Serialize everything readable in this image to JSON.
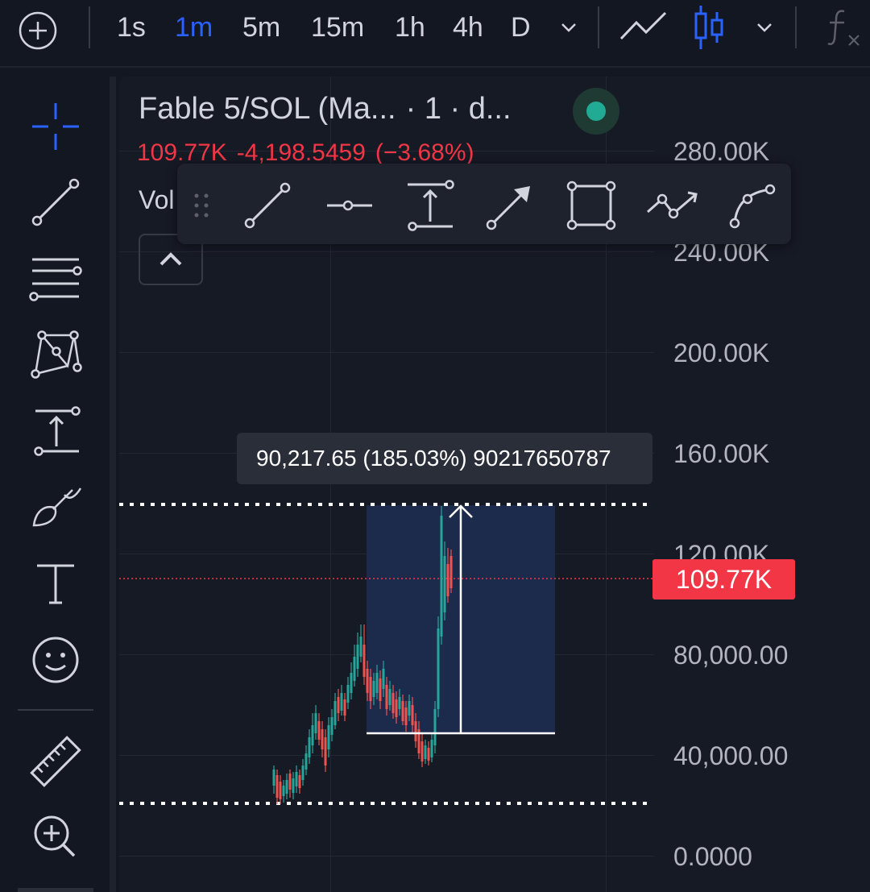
{
  "toolbar": {
    "add_icon": "plus-circle-icon",
    "intervals": [
      {
        "label": "1s",
        "active": false
      },
      {
        "label": "1m",
        "active": true
      },
      {
        "label": "5m",
        "active": false
      },
      {
        "label": "15m",
        "active": false
      },
      {
        "label": "1h",
        "active": false
      },
      {
        "label": "4h",
        "active": false
      },
      {
        "label": "D",
        "active": false
      }
    ],
    "interval_dropdown_icon": "chevron-down-icon",
    "chart_type_icons": [
      "line-chart-icon",
      "candlestick-icon"
    ],
    "chart_type_dropdown_icon": "chevron-down-icon",
    "indicators_icon": "function-icon"
  },
  "sidebar": {
    "tools": [
      "crosshair-icon",
      "trend-line-icon",
      "horizontal-lines-icon",
      "pattern-icon",
      "measure-icon",
      "brush-icon",
      "text-icon",
      "emoji-icon",
      "ruler-icon",
      "zoom-in-icon"
    ]
  },
  "legend": {
    "title": "Fable 5/SOL (Ma...",
    "subtitle": "· 1 · d...",
    "live_status_color": "#22ab94",
    "close": "109.77K",
    "change": "-4,198.5459",
    "change_pct": "(−3.68%)",
    "volume_label": "Vol",
    "collapse_icon": "chevron-up-icon"
  },
  "floating_toolbar": {
    "drag_icon": "drag-handle-icon",
    "tools": [
      "trend-line-icon",
      "horizontal-ray-icon",
      "price-range-icon",
      "arrow-icon",
      "rectangle-icon",
      "path-icon",
      "curve-icon"
    ]
  },
  "price_scale": {
    "labels": [
      "280.00K",
      "240.00K",
      "200.00K",
      "160.00K",
      "120.00K",
      "80,000.00",
      "40,000.00",
      "0.0000"
    ],
    "current_price": "109.77K",
    "current_price_color": "#f23645"
  },
  "measurement": {
    "tooltip": "90,217.65 (185.03%) 90217650787"
  },
  "colors": {
    "up": "#26a69a",
    "down": "#ef5350",
    "accent": "#2962ff",
    "range_fill": "#1c2b4c"
  }
}
